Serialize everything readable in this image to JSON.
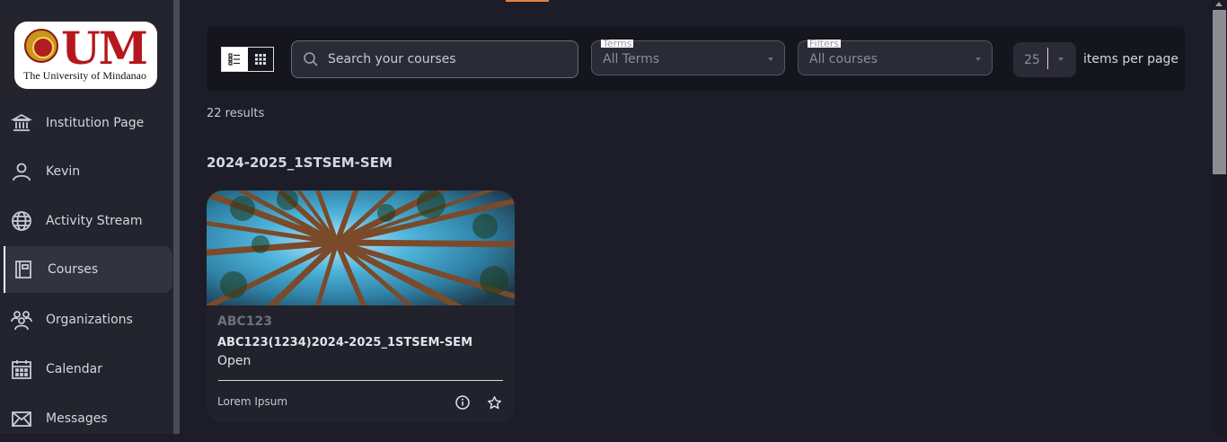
{
  "logo": {
    "wordmark": "UM",
    "subtitle": "The University of Mindanao"
  },
  "sidebar": {
    "items": [
      {
        "label": "Institution Page",
        "icon": "institution-icon"
      },
      {
        "label": "Kevin",
        "icon": "user-icon"
      },
      {
        "label": "Activity Stream",
        "icon": "globe-icon"
      },
      {
        "label": "Courses",
        "icon": "courses-icon",
        "active": true
      },
      {
        "label": "Organizations",
        "icon": "organizations-icon"
      },
      {
        "label": "Calendar",
        "icon": "calendar-icon"
      },
      {
        "label": "Messages",
        "icon": "envelope-icon"
      }
    ]
  },
  "toolbar": {
    "search_placeholder": "Search your courses",
    "terms": {
      "label": "Terms",
      "value": "All Terms"
    },
    "filters": {
      "label": "Filters",
      "value": "All courses"
    },
    "per_page": {
      "value": "25",
      "label": "items per page"
    }
  },
  "results": {
    "count_text": "22 results"
  },
  "term_group": {
    "heading": "2024-2025_1STSEM-SEM",
    "course": {
      "code": "ABC123",
      "title": "ABC123(1234)2024-2025_1STSEM-SEM",
      "status": "Open",
      "instructor": "Lorem Ipsum"
    }
  },
  "colors": {
    "accent": "#e6813a",
    "background": "#1d1d29",
    "sidebar": "#24242e"
  }
}
